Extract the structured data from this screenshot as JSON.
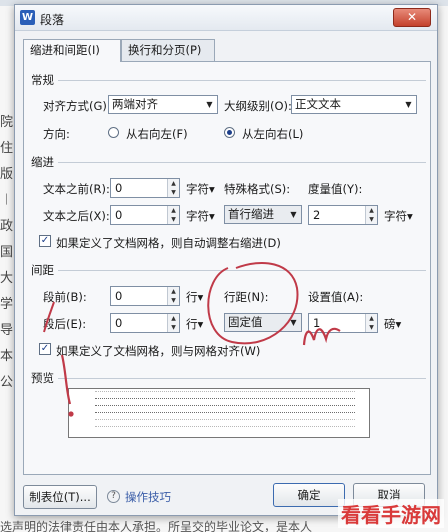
{
  "dialog": {
    "title": "段落",
    "app_icon_letter": "W",
    "close_glyph": "✕",
    "tabs": [
      {
        "label": "缩进和间距(I)"
      },
      {
        "label": "换行和分页(P)"
      }
    ]
  },
  "general": {
    "section": "常规",
    "align_label": "对齐方式(G):",
    "align_value": "两端对齐",
    "outline_label": "大纲级别(O):",
    "outline_value": "正文文本",
    "direction_label": "方向:",
    "rtl_label": "从右向左(F)",
    "ltr_label": "从左向右(L)"
  },
  "indent": {
    "section": "缩进",
    "before_label": "文本之前(R):",
    "before_value": "0",
    "before_unit": "字符",
    "after_label": "文本之后(X):",
    "after_value": "0",
    "after_unit": "字符",
    "special_label": "特殊格式(S):",
    "special_value": "首行缩进",
    "measure_label": "度量值(Y):",
    "measure_value": "2",
    "measure_unit": "字符",
    "auto_adjust_label": "如果定义了文档网格，则自动调整右缩进(D)",
    "auto_adjust_checked": true
  },
  "spacing": {
    "section": "间距",
    "before_label": "段前(B):",
    "before_value": "0",
    "before_unit": "行",
    "after_label": "段后(E):",
    "after_value": "0",
    "after_unit": "行",
    "line_label": "行距(N):",
    "line_value": "固定值",
    "set_label": "设置值(A):",
    "set_value": "1",
    "set_unit": "磅",
    "snap_grid_label": "如果定义了文档网格，则与网格对齐(W)",
    "snap_grid_checked": true
  },
  "preview": {
    "section": "预览"
  },
  "footer": {
    "tab_stops": "制表位(T)...",
    "tips": "操作技巧",
    "ok": "确定",
    "cancel": "取消"
  },
  "background": {
    "margin_chars": "院 住 版 ︱ 政 国 大 学 导 本 公",
    "bottom_text": "选声明的法律责任由本人承担。所呈交的毕业论文，是本人"
  },
  "watermark": "看看手游网",
  "colors": {
    "annotation_ink": "#c03a48",
    "title_bar": "#e4e9f0",
    "close_button": "#c4412c"
  }
}
